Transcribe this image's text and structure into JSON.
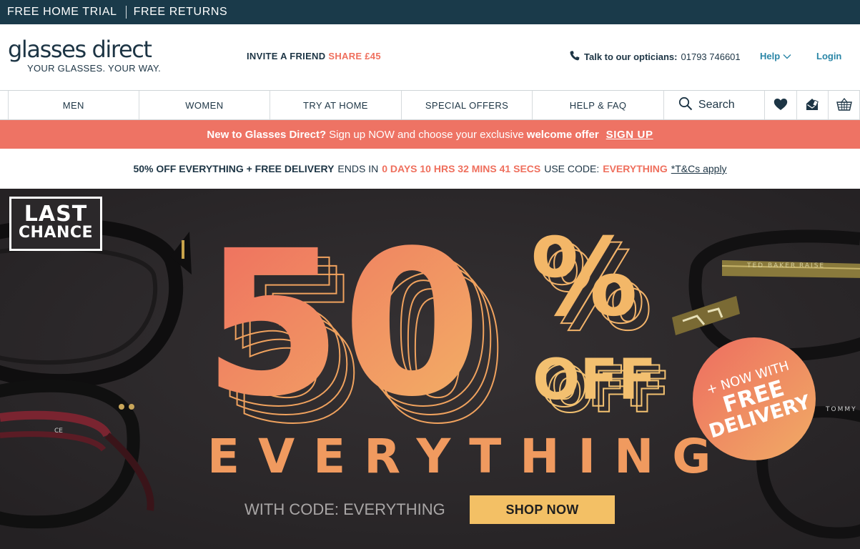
{
  "top_strip": {
    "items": [
      "FREE HOME TRIAL",
      "FREE RETURNS"
    ]
  },
  "header": {
    "logo_word": "glasses direct",
    "logo_tagline": "YOUR GLASSES. YOUR WAY.",
    "invite_label": "INVITE A FRIEND",
    "invite_share": "SHARE £45",
    "phone_label": "Talk to our opticians:",
    "phone_number": "01793 746601",
    "help_label": "Help",
    "login_label": "Login"
  },
  "nav": {
    "items": [
      "MEN",
      "WOMEN",
      "TRY AT HOME",
      "SPECIAL OFFERS",
      "HELP & FAQ"
    ],
    "search_label": "Search",
    "icons": [
      "heart-icon",
      "envelope-icon",
      "basket-icon"
    ]
  },
  "signup_bar": {
    "part1": "New to Glasses Direct?",
    "part2": "Sign up NOW and choose your exclusive",
    "part3": "welcome offer",
    "cta": "SIGN UP"
  },
  "countdown": {
    "offer": "50% OFF EVERYTHING + FREE DELIVERY",
    "ends_in": "ENDS IN",
    "time": "0 DAYS 10 HRS 32 MINS 41 SECS",
    "use_code": "USE CODE:",
    "code": "EVERYTHING",
    "terms": "*T&Cs apply"
  },
  "hero": {
    "badge_line1": "LAST",
    "badge_line2": "CHANCE",
    "big_number": "50",
    "percent": "%",
    "off": "OFF",
    "headline": "EVERYTHING",
    "code_text": "WITH CODE: EVERYTHING",
    "cta": "SHOP NOW",
    "delivery_line1": "+ NOW WITH",
    "delivery_line2": "FREE",
    "delivery_line3": "DELIVERY",
    "frame_brand_1": "TED BAKER",
    "frame_brand_2": "RAISE",
    "frame_brand_3": "TOMMY",
    "frame_mark": "CE"
  },
  "colors": {
    "dark_teal": "#1a3a4a",
    "coral": "#ee7364",
    "orange_accent": "#ef6f5d",
    "link_blue": "#2a86a7",
    "cta_yellow": "#f3c065",
    "hero_bg": "#2b282a"
  }
}
